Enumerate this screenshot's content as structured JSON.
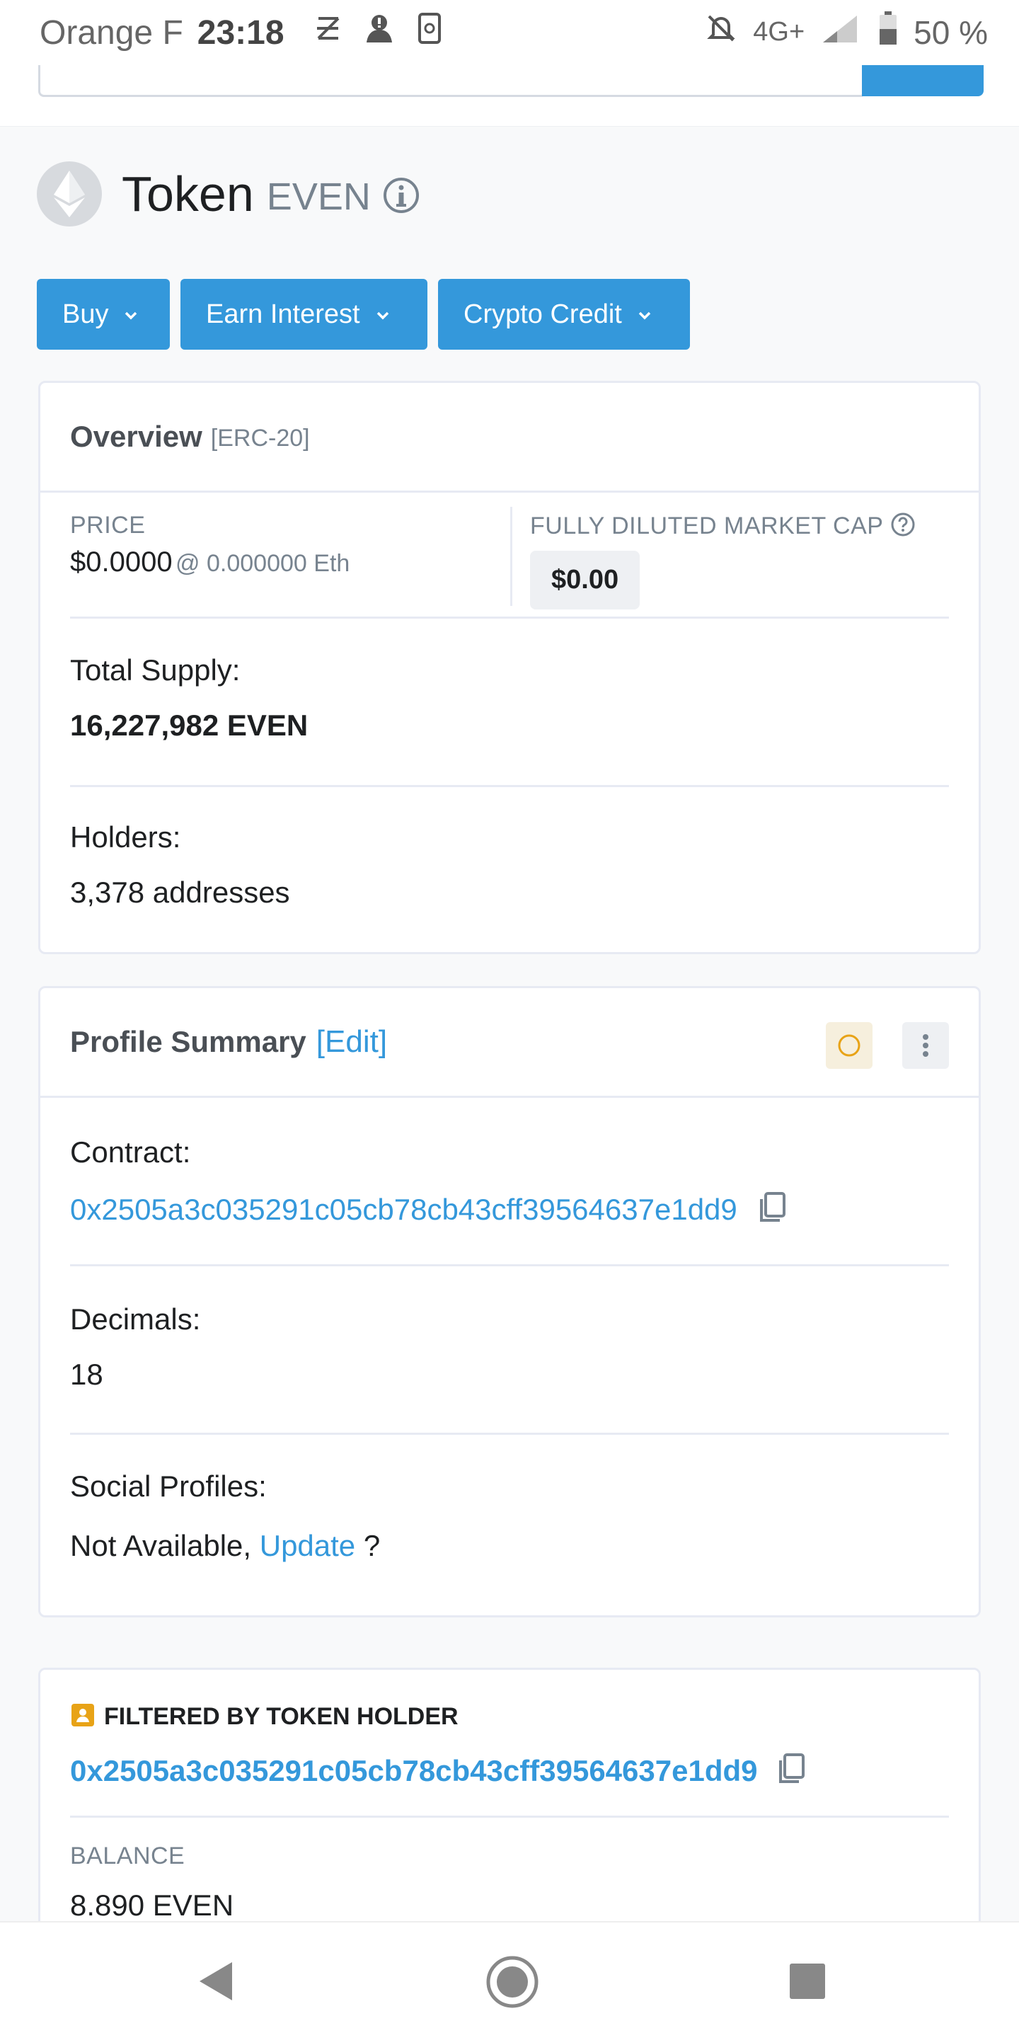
{
  "status": {
    "carrier": "Orange F",
    "time": "23:18",
    "network": "4G+",
    "battery": "50 %"
  },
  "token": {
    "name": "Token",
    "symbol": "EVEN"
  },
  "buttons": {
    "buy": "Buy",
    "earn": "Earn Interest",
    "credit": "Crypto Credit"
  },
  "overview": {
    "title": "Overview",
    "standard": "[ERC-20]",
    "price_label": "PRICE",
    "price": "$0.0000",
    "price_eth": "@ 0.000000 Eth",
    "mcap_label": "FULLY DILUTED MARKET CAP",
    "mcap": "$0.00",
    "supply_label": "Total Supply:",
    "supply": "16,227,982 EVEN",
    "holders_label": "Holders:",
    "holders": "3,378 addresses"
  },
  "profile": {
    "title": "Profile Summary",
    "edit": "[Edit]",
    "contract_label": "Contract:",
    "contract": "0x2505a3c035291c05cb78cb43cff39564637e1dd9",
    "decimals_label": "Decimals:",
    "decimals": "18",
    "social_label": "Social Profiles:",
    "social_na": "Not Available,",
    "social_update": "Update",
    "social_q": "?"
  },
  "filter": {
    "title": "FILTERED BY TOKEN HOLDER",
    "address": "0x2505a3c035291c05cb78cb43cff39564637e1dd9",
    "balance_label": "BALANCE",
    "balance": "8.890 EVEN"
  },
  "colors": {
    "accent": "#3498db",
    "warning": "#e8a317"
  }
}
